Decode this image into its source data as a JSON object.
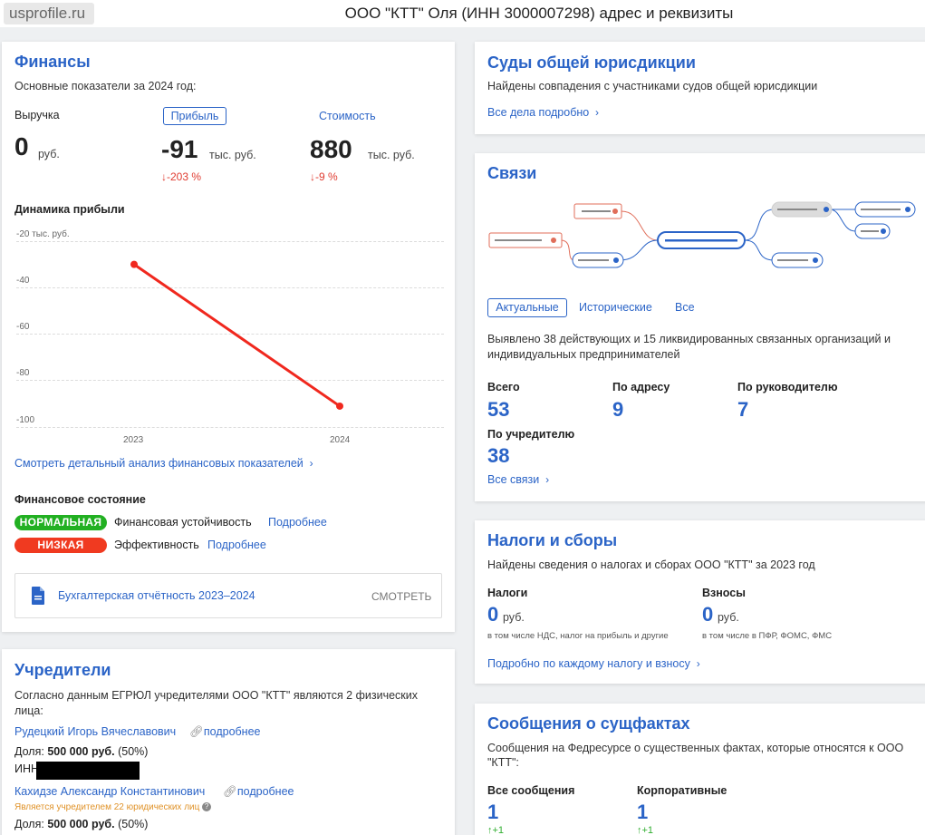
{
  "header": {
    "domain": "usprofile.ru",
    "title": "ООО \"КТТ\" Оля (ИНН 3000007298) адрес и реквизиты"
  },
  "finance": {
    "title": "Финансы",
    "subtitle": "Основные показатели за 2024 год:",
    "revenue_label": "Выручка",
    "profit_label": "Прибыль",
    "cost_label": "Стоимость",
    "revenue_value": "0",
    "revenue_unit": "руб.",
    "profit_value": "-91",
    "profit_unit": "тыс. руб.",
    "profit_change": "↓-203 %",
    "cost_value": "880",
    "cost_unit": "тыс. руб.",
    "cost_change": "↓-9 %",
    "dynamics_title": "Динамика прибыли",
    "detail_link": "Смотреть детальный анализ финансовых показателей",
    "state_title": "Финансовое состояние",
    "state_rows": [
      {
        "badge": "НОРМАЛЬНАЯ",
        "text": "Финансовая устойчивость",
        "link": "Подробнее"
      },
      {
        "badge": "НИЗКАЯ",
        "text": "Эффективность",
        "link": "Подробнее"
      }
    ],
    "doc_link": "Бухгалтерская отчётность 2023–2024",
    "doc_action": "СМОТРЕТЬ"
  },
  "chart_data": {
    "type": "line",
    "title": "Динамика прибыли",
    "x": [
      "2023",
      "2024"
    ],
    "series": [
      {
        "values": [
          -30,
          -91
        ]
      }
    ],
    "ylim": [
      -100,
      -20
    ],
    "yticks": [
      "-20 тыс. руб.",
      "-40",
      "-60",
      "-80",
      "-100"
    ],
    "yticks_values": [
      -20,
      -40,
      -60,
      -80,
      -100
    ],
    "grid": true,
    "line_color": "#f0281e"
  },
  "founders": {
    "title": "Учредители",
    "text": "Согласно данным ЕГРЮЛ учредителями ООО \"КТТ\" являются 2 физических лица:",
    "people": [
      {
        "name": "Рудецкий Игорь Вячеславович",
        "more": "подробнее",
        "share_label": "Доля:",
        "share_value": "500 000 руб.",
        "share_pct": "(50%)",
        "inn_label": "ИНН"
      },
      {
        "name": "Кахидзе Александр Константинович",
        "more": "подробнее",
        "note": "Является учредителем 22 юридических лиц",
        "share_label": "Доля:",
        "share_value": "500 000 руб.",
        "share_pct": "(50%)"
      }
    ]
  },
  "courts": {
    "title": "Суды общей юрисдикции",
    "text": "Найдены совпадения с участниками судов общей юрисдикции",
    "link": "Все дела подробно"
  },
  "links": {
    "title": "Связи",
    "tabs": [
      "Актуальные",
      "Исторические",
      "Все"
    ],
    "text": "Выявлено 38 действующих и 15 ликвидированных связанных организаций и индивидуальных предпринимателей",
    "stats": [
      {
        "label": "Всего",
        "value": "53"
      },
      {
        "label": "По адресу",
        "value": "9"
      },
      {
        "label": "По руководителю",
        "value": "7"
      },
      {
        "label": "По учредителю",
        "value": "38"
      }
    ],
    "all_link": "Все связи"
  },
  "taxes": {
    "title": "Налоги и сборы",
    "text": "Найдены сведения о налогах и сборах ООО \"КТТ\" за 2023 год",
    "tax_label": "Налоги",
    "tax_value": "0",
    "tax_unit": "руб.",
    "tax_note": "в том числе НДС, налог на прибыль и другие",
    "fee_label": "Взносы",
    "fee_value": "0",
    "fee_unit": "руб.",
    "fee_note": "в том числе в ПФР, ФОМС, ФМС",
    "link": "Подробно по каждому налогу и взносу"
  },
  "facts": {
    "title": "Сообщения о сущфактах",
    "text": "Сообщения на Федресурсе о существенных фактах, которые относятся к ООО \"КТТ\":",
    "all_label": "Все сообщения",
    "all_value": "1",
    "all_delta": "↑+1",
    "corp_label": "Корпоративные",
    "corp_value": "1",
    "corp_delta": "↑+1"
  },
  "colors": {
    "accent": "#2b64c7",
    "negative": "#e03c31",
    "badge_green": "#22b022",
    "badge_red": "#f03a20"
  }
}
